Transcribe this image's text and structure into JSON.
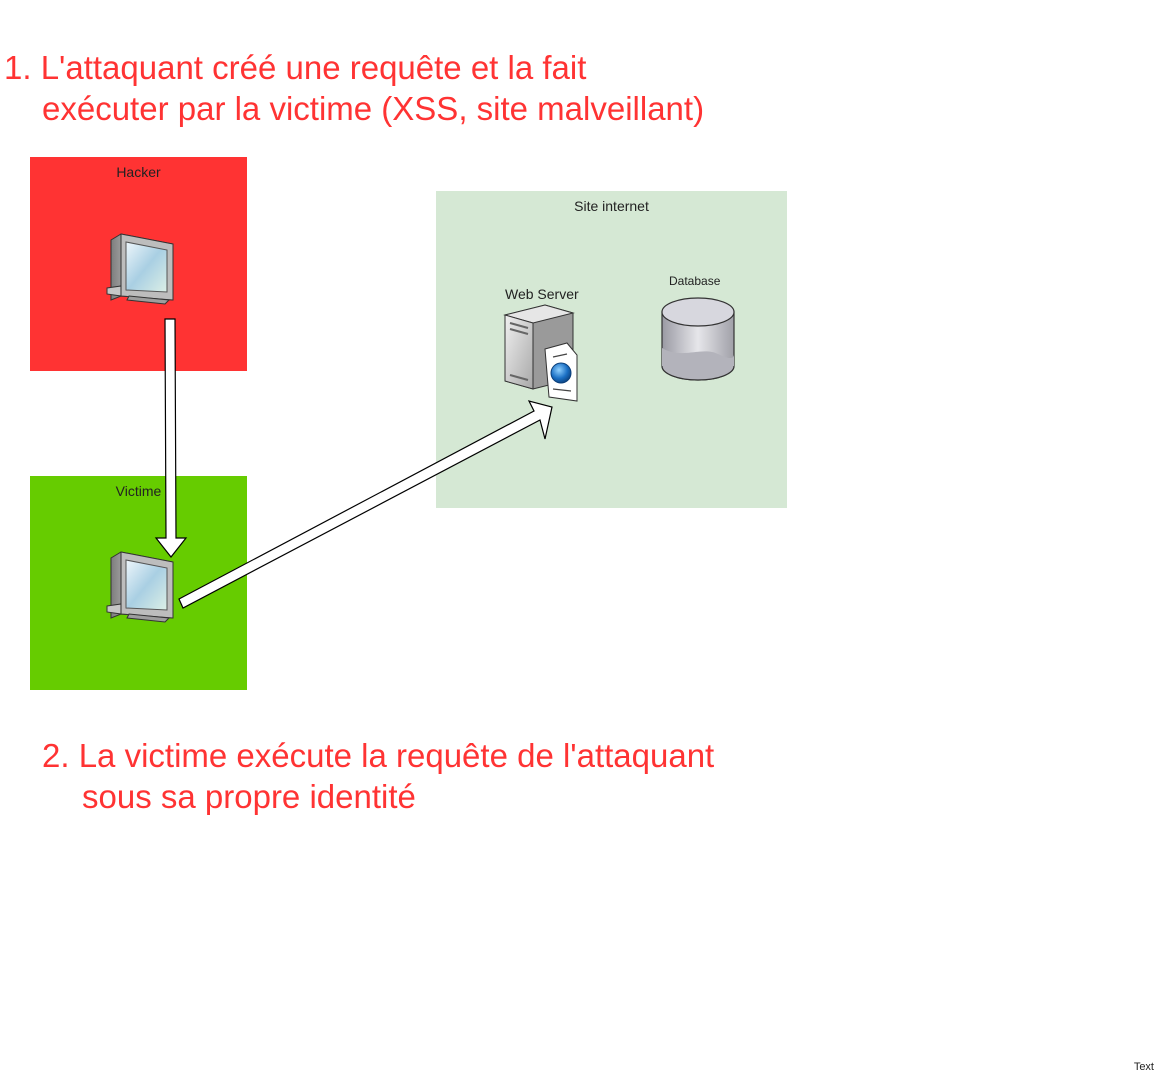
{
  "steps": {
    "step1": {
      "line1": "1. L'attaquant créé une requête et la fait",
      "line2": "exécuter par la victime (XSS, site malveillant)"
    },
    "step2": {
      "line1": "2. La victime exécute la requête de l'attaquant",
      "line2": "sous sa propre identité"
    }
  },
  "zones": {
    "hacker": {
      "label": "Hacker",
      "color": "#ff3333"
    },
    "victim": {
      "label": "Victime",
      "color": "#66cc00"
    },
    "site": {
      "label": "Site internet",
      "color": "#d5e8d4"
    }
  },
  "nodes": {
    "web_server": {
      "label": "Web Server",
      "icon": "web-server-icon"
    },
    "database": {
      "label": "Database",
      "icon": "database-icon"
    },
    "hacker_pc": {
      "icon": "computer-icon"
    },
    "victim_pc": {
      "icon": "computer-icon"
    }
  },
  "footer": {
    "text": "Text"
  },
  "colors": {
    "step_text": "#ff3333",
    "arrow_fill": "#ffffff",
    "arrow_stroke": "#000000"
  }
}
